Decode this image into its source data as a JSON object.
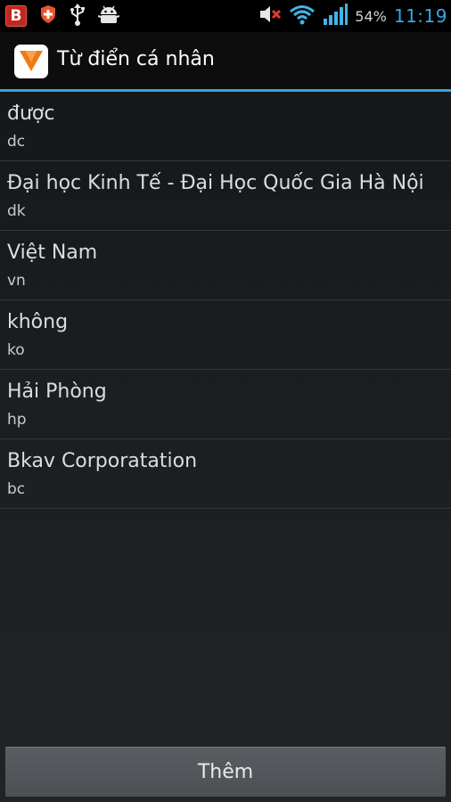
{
  "status_bar": {
    "icons_left": [
      "bkav-b-icon",
      "shield-icon",
      "usb-icon",
      "android-debug-icon"
    ],
    "b_label": "B",
    "icons_right": [
      "volume-muted-icon",
      "wifi-icon",
      "signal-icon"
    ],
    "battery": "54%",
    "time": "11:19",
    "time_color": "#3aa7e0"
  },
  "action_bar": {
    "title": "Từ điển cá nhân",
    "accent_color": "#33a4d8"
  },
  "entries": [
    {
      "word": "được",
      "shortcut": "dc"
    },
    {
      "word": "Đại học Kinh Tế - Đại Học Quốc Gia Hà Nội",
      "shortcut": "dk"
    },
    {
      "word": "Việt Nam",
      "shortcut": "vn"
    },
    {
      "word": "không",
      "shortcut": "ko"
    },
    {
      "word": "Hải Phòng",
      "shortcut": "hp"
    },
    {
      "word": "Bkav Corporatation",
      "shortcut": "bc"
    }
  ],
  "add_button": {
    "label": "Thêm"
  }
}
